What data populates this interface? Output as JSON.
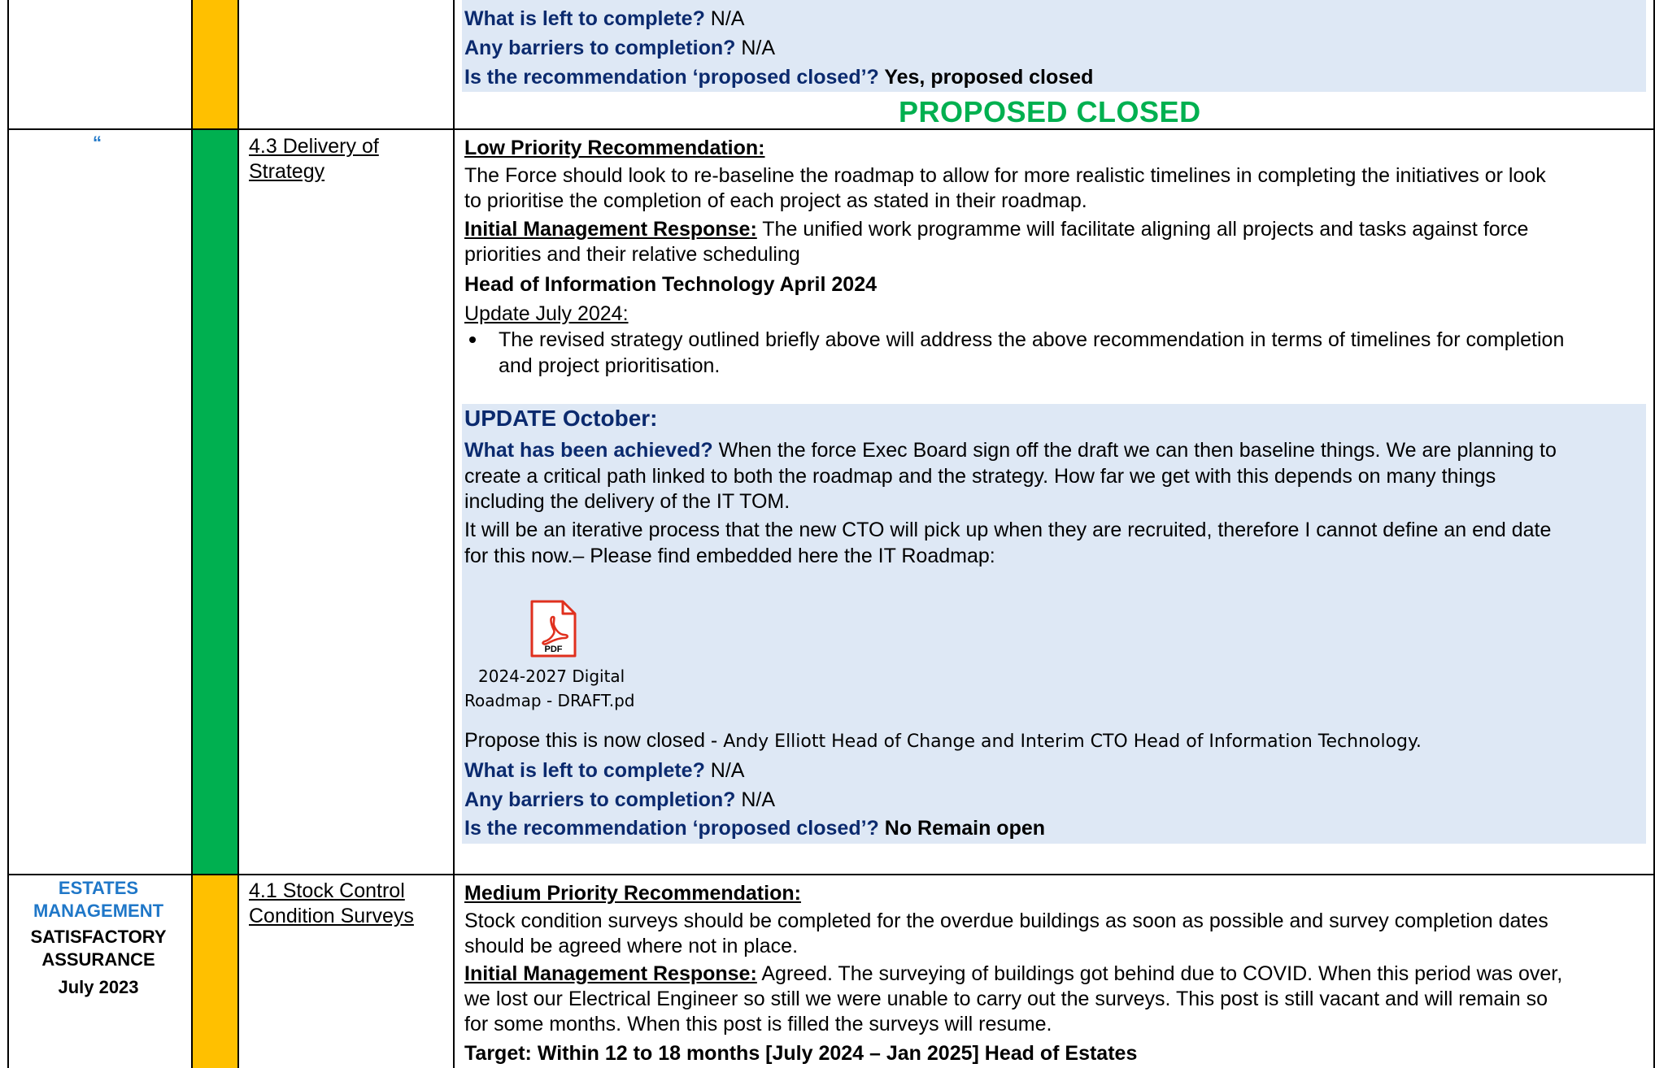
{
  "row_top": {
    "left_to_complete_label": "What is left to complete?",
    "left_to_complete_value": " N/A",
    "barriers_label": "Any barriers to completion?",
    "barriers_value": " N/A",
    "proposed_closed_label": "Is the recommendation ‘proposed closed’?",
    "proposed_closed_value": " Yes, proposed closed",
    "status_banner": "PROPOSED CLOSED"
  },
  "row_strategy": {
    "ditto_mark": "“",
    "ref_line1": "4.3 Delivery of",
    "ref_line2": "Strategy",
    "priority_heading": "Low Priority Recommendation:",
    "rec_line1": "The Force should look to re-baseline the roadmap to allow for more realistic timelines in completing the initiatives or look",
    "rec_line2": "to prioritise the completion of each project as stated in their roadmap.",
    "imr_label": "Initial Management Response:",
    "imr_line1": " The unified work programme will facilitate aligning all projects and tasks against force",
    "imr_line2": "priorities and their relative scheduling",
    "owner": "Head of Information Technology April 2024",
    "update_july": "Update July 2024:",
    "bullet_line1": "The revised strategy outlined briefly above will address the above recommendation in terms of timelines for completion",
    "bullet_line2": "and project prioritisation.",
    "update_title": "UPDATE October:",
    "achieved_label": "What has been achieved?",
    "achieved_line1": " When the force Exec Board sign off the draft we can then baseline things. We are planning to",
    "achieved_line2": "create a critical path linked to both the roadmap and the strategy. How far we get with this depends on many things",
    "achieved_line3": "including the delivery of the IT TOM.",
    "iter_line1": "It will be an iterative process that the new CTO will pick up when they are recruited, therefore I cannot define an end date",
    "iter_line2": "for this now.– Please find embedded here the IT Roadmap:",
    "attachment_line1": "2024-2027 Digital",
    "attachment_line2": "Roadmap - DRAFT.pd",
    "pdf_badge": "PDF",
    "propose_prefix": "Propose this is now closed - ",
    "propose_name": "Andy Elliott Head of Change and Interim CTO Head of Information Technology.",
    "left_to_complete_label": "What is left to complete?",
    "left_to_complete_value": " N/A",
    "barriers_label": "Any barriers to completion?",
    "barriers_value": " N/A",
    "proposed_closed_label": "Is the recommendation ‘proposed closed’?",
    "proposed_closed_value": " No Remain open"
  },
  "row_estates": {
    "area_line1": "ESTATES",
    "area_line2": "MANAGEMENT",
    "assurance_line1": "SATISFACTORY",
    "assurance_line2": "ASSURANCE",
    "date": "July 2023",
    "ref_line1": "4.1 Stock Control",
    "ref_line2": "Condition Surveys",
    "priority_heading": "Medium Priority Recommendation:",
    "rec_line1": "Stock condition surveys should be completed for the overdue buildings as soon as possible and survey completion dates",
    "rec_line2": "should be agreed where not in place.",
    "imr_label": "Initial Management Response:",
    "imr_line1": " Agreed. The surveying of buildings got behind due to COVID. When this period was over,",
    "imr_line2": "we lost our Electrical Engineer so still we were unable to carry out the surveys. This post is still vacant and will remain so",
    "imr_line3": "for some months. When this post is filled the surveys will resume.",
    "target": "Target: Within 12 to 18 months [July 2024 – Jan 2025] Head of Estates"
  },
  "colors": {
    "amber": "#FFC000",
    "green": "#00B050",
    "panel_blue": "#DEE8F5",
    "label_navy": "#0B2A6E",
    "area_blue": "#1F77C8"
  }
}
